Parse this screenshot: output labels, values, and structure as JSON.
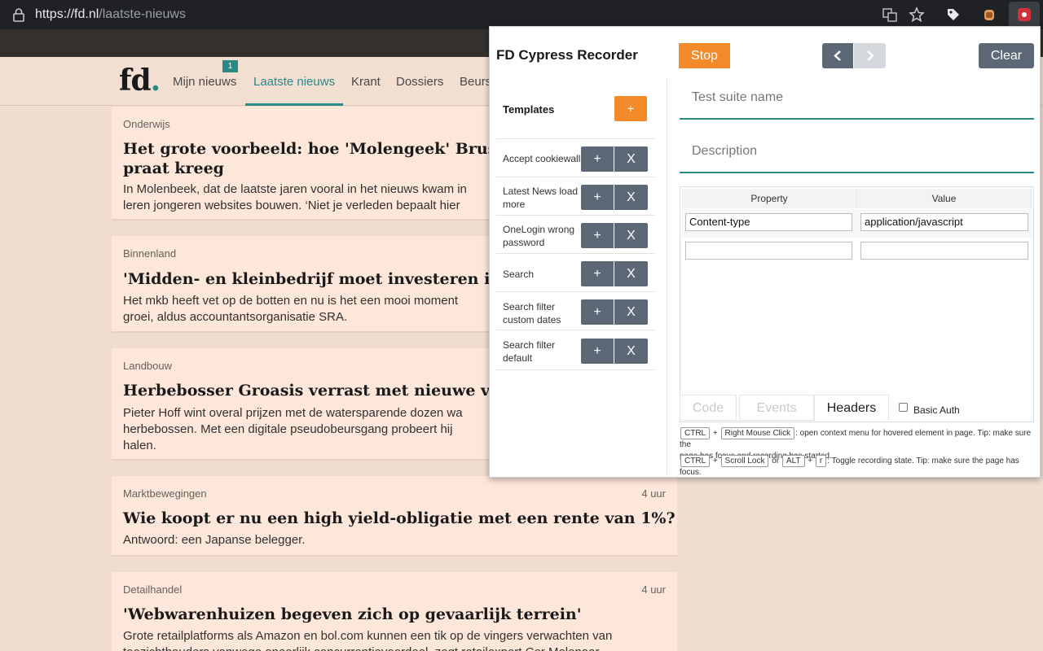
{
  "browser": {
    "url_host": "https://fd.nl",
    "url_path": "/laatste-nieuws"
  },
  "site": {
    "logo_text": "fd",
    "logo_dot": ".",
    "nav": [
      {
        "label": "Mijn nieuws",
        "badge": "1"
      },
      {
        "label": "Laatste nieuws"
      },
      {
        "label": "Krant"
      },
      {
        "label": "Dossiers"
      },
      {
        "label": "Beurs"
      }
    ]
  },
  "articles": [
    {
      "category": "Onderwijs",
      "time": "",
      "headline": "Het grote voorbeeld: hoe 'Molengeek' Brusselse",
      "headline2": "praat kreeg",
      "summary": "In Molenbeek, dat de laatste jaren vooral in het nieuws kwam in",
      "summary2": "leren jongeren websites bouwen. ‘Niet je verleden bepaalt hier"
    },
    {
      "category": "Binnenland",
      "time": "",
      "headline": "'Midden- en kleinbedrijf moet investeren in inn",
      "headline2": "",
      "summary": "Het mkb heeft vet op de botten en nu is het een mooi moment",
      "summary2": "groei, aldus accountantsorganisatie SRA."
    },
    {
      "category": "Landbouw",
      "time": "",
      "headline": "Herbebosser Groasis verrast met nieuwe vorm v",
      "headline2": "",
      "summary": "Pieter Hoff wint overal prijzen met de watersparende dozen wa",
      "summary2": "herbebossen. Met een digitale pseudobeursgang probeert hij",
      "summary3": "halen."
    },
    {
      "category": "Marktbewegingen",
      "time": "4 uur",
      "headline": "Wie koopt er nu een high yield-obligatie met een rente van 1%?",
      "headline2": "",
      "summary": "Antwoord: een Japanse belegger.",
      "summary2": ""
    },
    {
      "category": "Detailhandel",
      "time": "4 uur",
      "headline": "'Webwarenhuizen begeven zich op gevaarlijk terrein'",
      "headline2": "",
      "summary": "Grote retailplatforms als Amazon en bol.com kunnen een tik op de vingers verwachten van",
      "summary2": "toezichthouders vanwege oneerlijk concurrentievoordeel, zegt retailexpert Cor Molenaar."
    }
  ],
  "recorder": {
    "title": "FD Cypress Recorder",
    "stop_label": "Stop",
    "clear_label": "Clear",
    "prev_icon": "chevron-left-icon",
    "next_icon": "chevron-right-icon",
    "templates_title": "Templates",
    "add_template_label": "+",
    "templates": [
      {
        "name": "Accept cookiewall"
      },
      {
        "name": "Latest News load more"
      },
      {
        "name": "OneLogin wrong password"
      },
      {
        "name": "Search"
      },
      {
        "name": "Search filter custom dates"
      },
      {
        "name": "Search filter default"
      }
    ],
    "template_add": "+",
    "template_remove": "X",
    "suite_name_placeholder": "Test suite name",
    "description_placeholder": "Description",
    "table": {
      "col_property": "Property",
      "col_value": "Value",
      "rows": [
        {
          "property": "Content-type",
          "value": "application/javascript"
        },
        {
          "property": "",
          "value": ""
        }
      ]
    },
    "tabs": [
      {
        "label": "Code",
        "state": "inactive"
      },
      {
        "label": "Events",
        "state": "inactive"
      },
      {
        "label": "Headers",
        "state": "active"
      }
    ],
    "basic_auth_label": "Basic Auth",
    "hint1": {
      "key1": "CTRL",
      "plus": "+",
      "key2": "Right Mouse Click",
      "text": ": open context menu for hovered element in page. Tip: make sure the",
      "text2": "page has focus and recording has started."
    },
    "hint2": {
      "key1": "CTRL",
      "plus": "+",
      "key2": "Scroll Lock",
      "or": "or",
      "key3": "ALT",
      "plus2": "+",
      "key4": "r",
      "text": ": Toggle recording state. Tip: make sure the page has focus."
    }
  },
  "colors": {
    "accent_teal": "#2a8a87",
    "stop_orange": "#f58a2b",
    "button_slate": "#5d6877",
    "page_bg": "#f0ddd0",
    "card_bg": "#fde7da"
  }
}
